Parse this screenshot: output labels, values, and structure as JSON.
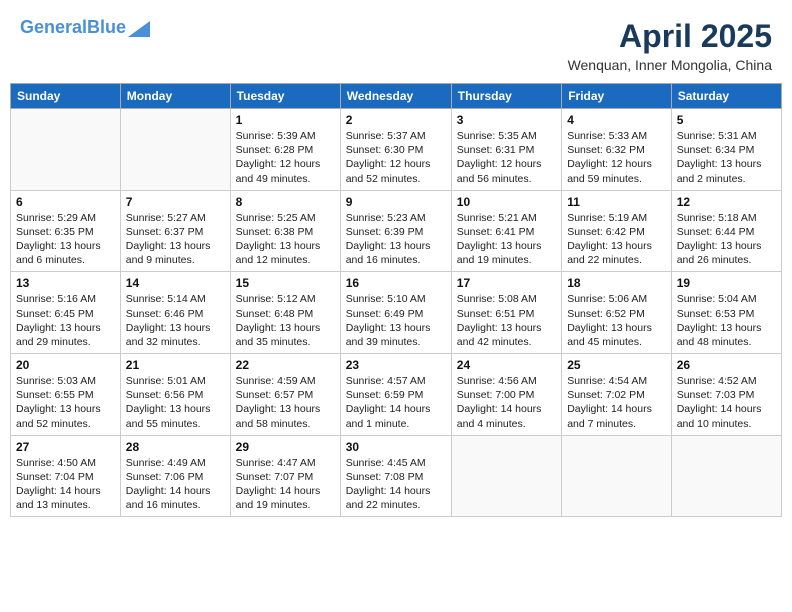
{
  "header": {
    "logo_line1": "General",
    "logo_line2": "Blue",
    "month_title": "April 2025",
    "location": "Wenquan, Inner Mongolia, China"
  },
  "weekdays": [
    "Sunday",
    "Monday",
    "Tuesday",
    "Wednesday",
    "Thursday",
    "Friday",
    "Saturday"
  ],
  "weeks": [
    [
      {
        "day": "",
        "info": ""
      },
      {
        "day": "",
        "info": ""
      },
      {
        "day": "1",
        "info": "Sunrise: 5:39 AM\nSunset: 6:28 PM\nDaylight: 12 hours\nand 49 minutes."
      },
      {
        "day": "2",
        "info": "Sunrise: 5:37 AM\nSunset: 6:30 PM\nDaylight: 12 hours\nand 52 minutes."
      },
      {
        "day": "3",
        "info": "Sunrise: 5:35 AM\nSunset: 6:31 PM\nDaylight: 12 hours\nand 56 minutes."
      },
      {
        "day": "4",
        "info": "Sunrise: 5:33 AM\nSunset: 6:32 PM\nDaylight: 12 hours\nand 59 minutes."
      },
      {
        "day": "5",
        "info": "Sunrise: 5:31 AM\nSunset: 6:34 PM\nDaylight: 13 hours\nand 2 minutes."
      }
    ],
    [
      {
        "day": "6",
        "info": "Sunrise: 5:29 AM\nSunset: 6:35 PM\nDaylight: 13 hours\nand 6 minutes."
      },
      {
        "day": "7",
        "info": "Sunrise: 5:27 AM\nSunset: 6:37 PM\nDaylight: 13 hours\nand 9 minutes."
      },
      {
        "day": "8",
        "info": "Sunrise: 5:25 AM\nSunset: 6:38 PM\nDaylight: 13 hours\nand 12 minutes."
      },
      {
        "day": "9",
        "info": "Sunrise: 5:23 AM\nSunset: 6:39 PM\nDaylight: 13 hours\nand 16 minutes."
      },
      {
        "day": "10",
        "info": "Sunrise: 5:21 AM\nSunset: 6:41 PM\nDaylight: 13 hours\nand 19 minutes."
      },
      {
        "day": "11",
        "info": "Sunrise: 5:19 AM\nSunset: 6:42 PM\nDaylight: 13 hours\nand 22 minutes."
      },
      {
        "day": "12",
        "info": "Sunrise: 5:18 AM\nSunset: 6:44 PM\nDaylight: 13 hours\nand 26 minutes."
      }
    ],
    [
      {
        "day": "13",
        "info": "Sunrise: 5:16 AM\nSunset: 6:45 PM\nDaylight: 13 hours\nand 29 minutes."
      },
      {
        "day": "14",
        "info": "Sunrise: 5:14 AM\nSunset: 6:46 PM\nDaylight: 13 hours\nand 32 minutes."
      },
      {
        "day": "15",
        "info": "Sunrise: 5:12 AM\nSunset: 6:48 PM\nDaylight: 13 hours\nand 35 minutes."
      },
      {
        "day": "16",
        "info": "Sunrise: 5:10 AM\nSunset: 6:49 PM\nDaylight: 13 hours\nand 39 minutes."
      },
      {
        "day": "17",
        "info": "Sunrise: 5:08 AM\nSunset: 6:51 PM\nDaylight: 13 hours\nand 42 minutes."
      },
      {
        "day": "18",
        "info": "Sunrise: 5:06 AM\nSunset: 6:52 PM\nDaylight: 13 hours\nand 45 minutes."
      },
      {
        "day": "19",
        "info": "Sunrise: 5:04 AM\nSunset: 6:53 PM\nDaylight: 13 hours\nand 48 minutes."
      }
    ],
    [
      {
        "day": "20",
        "info": "Sunrise: 5:03 AM\nSunset: 6:55 PM\nDaylight: 13 hours\nand 52 minutes."
      },
      {
        "day": "21",
        "info": "Sunrise: 5:01 AM\nSunset: 6:56 PM\nDaylight: 13 hours\nand 55 minutes."
      },
      {
        "day": "22",
        "info": "Sunrise: 4:59 AM\nSunset: 6:57 PM\nDaylight: 13 hours\nand 58 minutes."
      },
      {
        "day": "23",
        "info": "Sunrise: 4:57 AM\nSunset: 6:59 PM\nDaylight: 14 hours\nand 1 minute."
      },
      {
        "day": "24",
        "info": "Sunrise: 4:56 AM\nSunset: 7:00 PM\nDaylight: 14 hours\nand 4 minutes."
      },
      {
        "day": "25",
        "info": "Sunrise: 4:54 AM\nSunset: 7:02 PM\nDaylight: 14 hours\nand 7 minutes."
      },
      {
        "day": "26",
        "info": "Sunrise: 4:52 AM\nSunset: 7:03 PM\nDaylight: 14 hours\nand 10 minutes."
      }
    ],
    [
      {
        "day": "27",
        "info": "Sunrise: 4:50 AM\nSunset: 7:04 PM\nDaylight: 14 hours\nand 13 minutes."
      },
      {
        "day": "28",
        "info": "Sunrise: 4:49 AM\nSunset: 7:06 PM\nDaylight: 14 hours\nand 16 minutes."
      },
      {
        "day": "29",
        "info": "Sunrise: 4:47 AM\nSunset: 7:07 PM\nDaylight: 14 hours\nand 19 minutes."
      },
      {
        "day": "30",
        "info": "Sunrise: 4:45 AM\nSunset: 7:08 PM\nDaylight: 14 hours\nand 22 minutes."
      },
      {
        "day": "",
        "info": ""
      },
      {
        "day": "",
        "info": ""
      },
      {
        "day": "",
        "info": ""
      }
    ]
  ]
}
